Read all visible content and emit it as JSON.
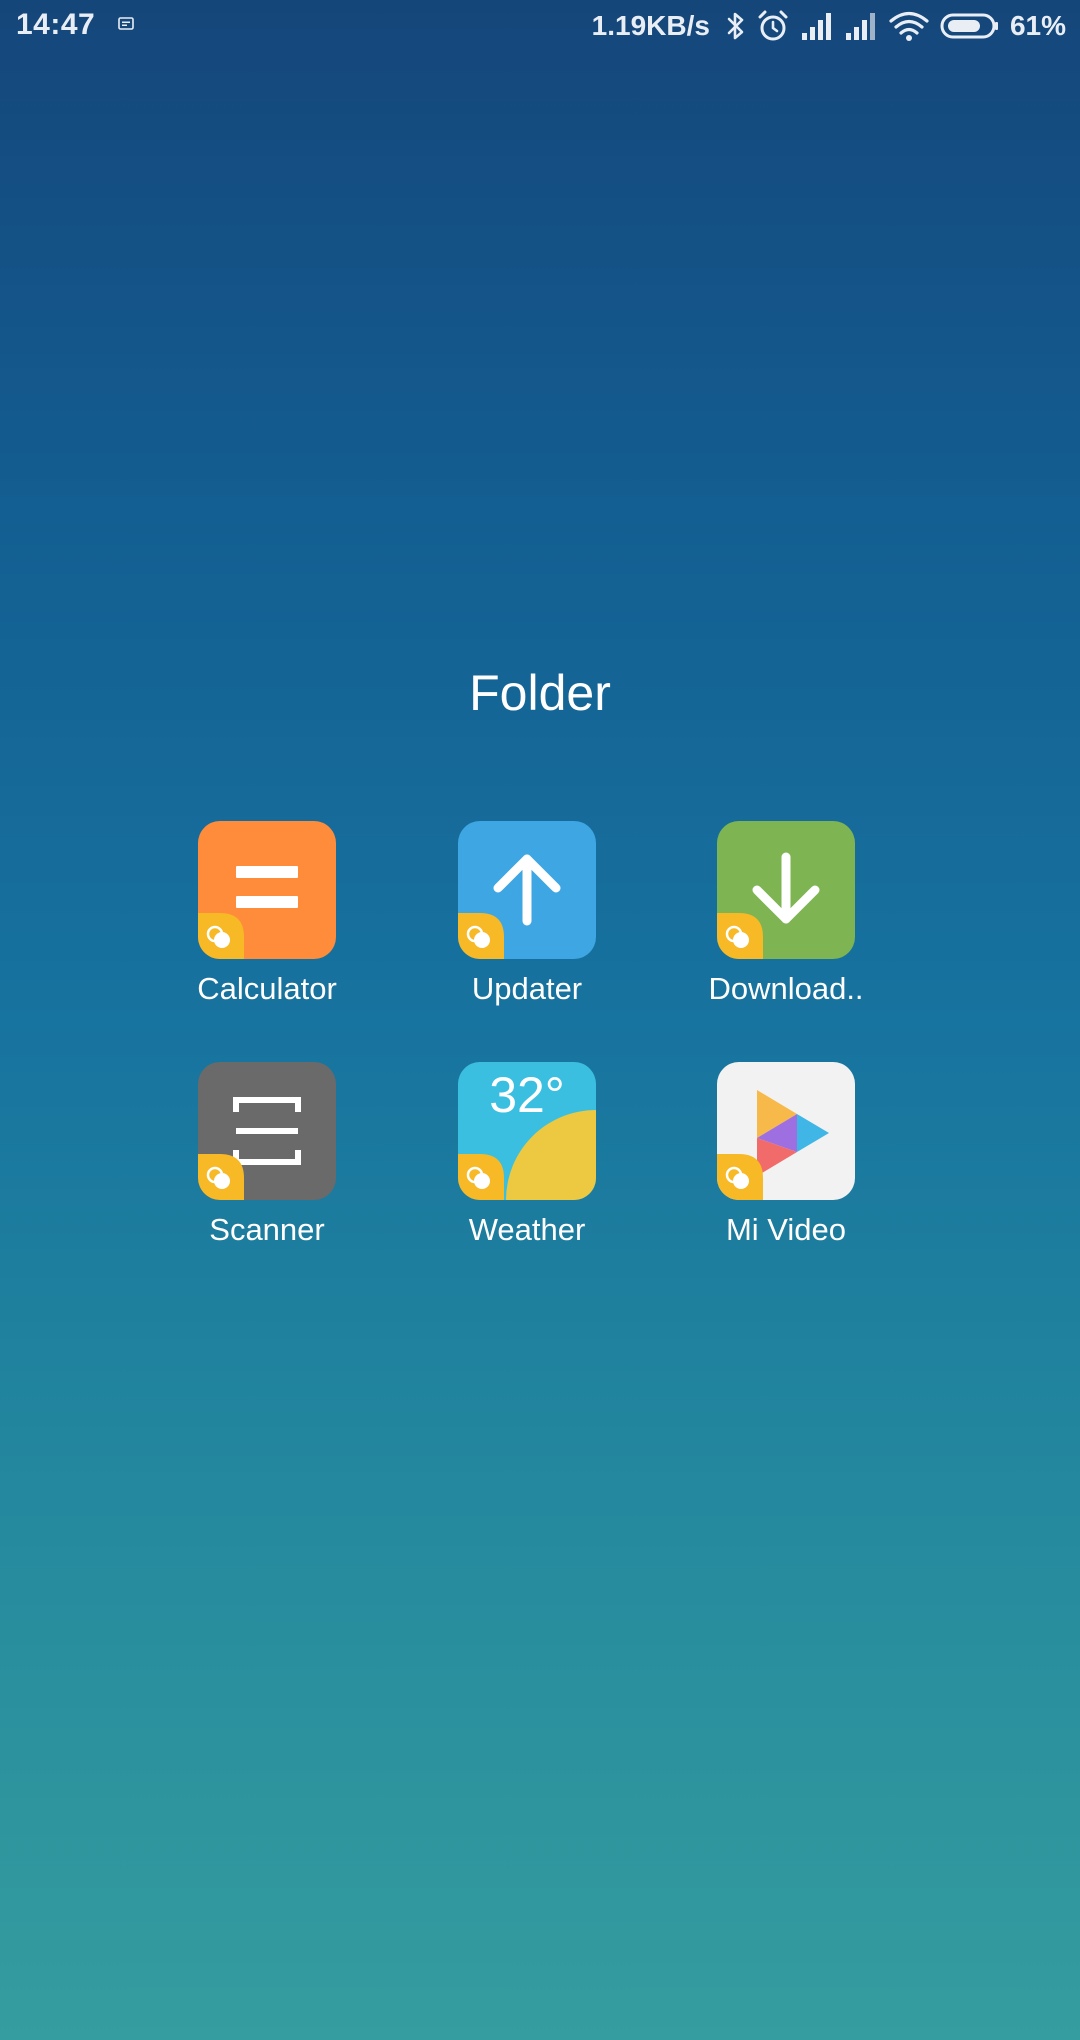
{
  "status_bar": {
    "time": "14:47",
    "network_speed": "1.19KB/s",
    "battery_percent": "61%",
    "icons": [
      "notification-icon",
      "bluetooth-icon",
      "alarm-icon",
      "signal-icon",
      "signal-icon",
      "wifi-icon",
      "battery-icon"
    ]
  },
  "folder": {
    "title": "Folder",
    "apps": [
      {
        "label": "Calculator",
        "icon": "calculator-icon",
        "color": "#ff8c3a"
      },
      {
        "label": "Updater",
        "icon": "updater-icon",
        "color": "#3da6e3"
      },
      {
        "label": "Download..",
        "icon": "downloads-icon",
        "color": "#7fb453"
      },
      {
        "label": "Scanner",
        "icon": "scanner-icon",
        "color": "#6a6a6a"
      },
      {
        "label": "Weather",
        "icon": "weather-icon",
        "color": "#3bbfe0",
        "temperature": "32°"
      },
      {
        "label": "Mi Video",
        "icon": "mi-video-icon",
        "color": "#f2f2f2"
      }
    ]
  },
  "colors": {
    "badge": "#f7b925",
    "weather_sun": "#ecc940"
  }
}
